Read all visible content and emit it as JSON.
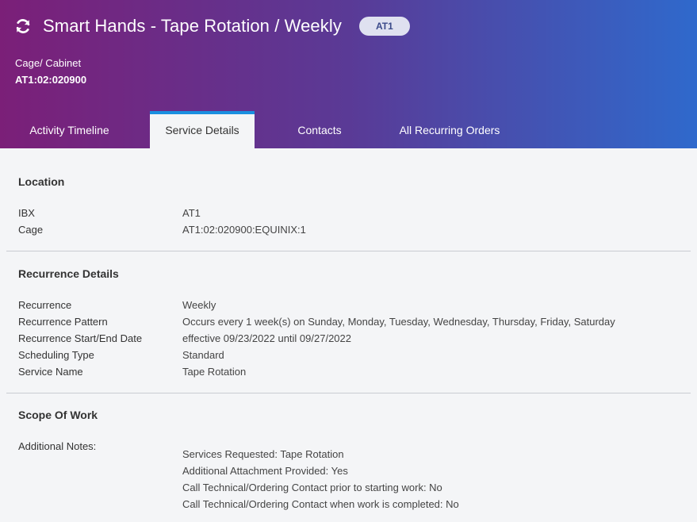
{
  "header": {
    "title": "Smart Hands - Tape Rotation / Weekly",
    "badge": "AT1",
    "cage_label": "Cage/ Cabinet",
    "cage_value": "AT1:02:020900"
  },
  "tabs": [
    {
      "label": "Activity Timeline"
    },
    {
      "label": "Service Details",
      "active": true
    },
    {
      "label": "Contacts"
    },
    {
      "label": "All Recurring Orders"
    }
  ],
  "location": {
    "title": "Location",
    "rows": [
      {
        "key": "IBX",
        "value": "AT1"
      },
      {
        "key": "Cage",
        "value": "AT1:02:020900:EQUINIX:1"
      }
    ]
  },
  "recurrence": {
    "title": "Recurrence Details",
    "rows": [
      {
        "key": "Recurrence",
        "value": "Weekly"
      },
      {
        "key": "Recurrence Pattern",
        "value": "Occurs every 1 week(s) on Sunday, Monday, Tuesday, Wednesday, Thursday, Friday, Saturday"
      },
      {
        "key": "Recurrence Start/End Date",
        "value": "effective 09/23/2022 until 09/27/2022"
      },
      {
        "key": "Scheduling Type",
        "value": "Standard"
      },
      {
        "key": "Service Name",
        "value": "Tape Rotation"
      }
    ]
  },
  "scope": {
    "title": "Scope Of Work",
    "notes_label": "Additional Notes:",
    "notes": [
      "Services Requested: Tape Rotation",
      "Additional Attachment Provided: Yes",
      "Call Technical/Ordering Contact prior to starting work: No",
      "Call Technical/Ordering Contact when work is completed: No"
    ]
  }
}
